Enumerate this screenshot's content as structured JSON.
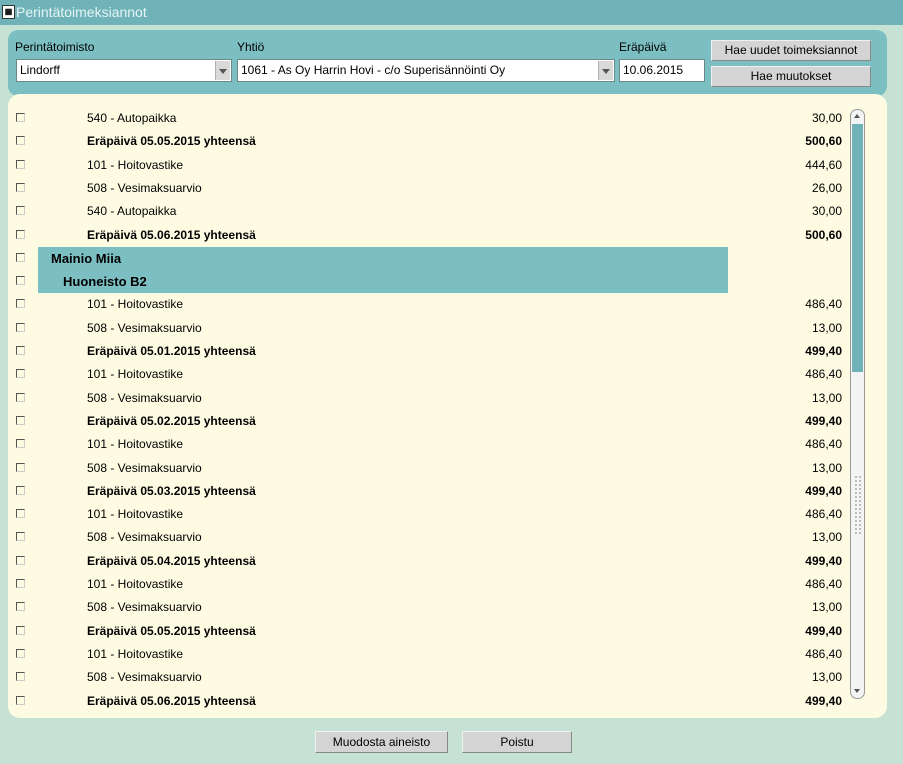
{
  "window": {
    "title": "Perintätoimeksiannot",
    "icon": "app-icon"
  },
  "filters": {
    "agency_label": "Perintätoimisto",
    "agency_value": "Lindorff",
    "company_label": "Yhtiö",
    "company_value": "1061 - As Oy Harrin Hovi - c/o Superisännöinti Oy",
    "due_label": "Eräpäivä",
    "due_value": "10.06.2015",
    "fetch_new_label": "Hae uudet toimeksiannot",
    "fetch_changes_label": "Hae muutokset"
  },
  "rows": [
    {
      "kind": "item",
      "desc": "540 - Autopaikka",
      "amount": "30,00"
    },
    {
      "kind": "total",
      "desc": "Eräpäivä 05.05.2015 yhteensä",
      "amount": "500,60"
    },
    {
      "kind": "item",
      "desc": "101 - Hoitovastike",
      "amount": "444,60"
    },
    {
      "kind": "item",
      "desc": "508 - Vesimaksuarvio",
      "amount": "26,00"
    },
    {
      "kind": "item",
      "desc": "540 - Autopaikka",
      "amount": "30,00"
    },
    {
      "kind": "total",
      "desc": "Eräpäivä 05.06.2015 yhteensä",
      "amount": "500,60"
    },
    {
      "kind": "person",
      "desc": "Mainio Miia",
      "amount": ""
    },
    {
      "kind": "apartment",
      "desc": "Huoneisto B2",
      "amount": ""
    },
    {
      "kind": "item",
      "desc": "101 - Hoitovastike",
      "amount": "486,40"
    },
    {
      "kind": "item",
      "desc": "508 - Vesimaksuarvio",
      "amount": "13,00"
    },
    {
      "kind": "total",
      "desc": "Eräpäivä 05.01.2015 yhteensä",
      "amount": "499,40"
    },
    {
      "kind": "item",
      "desc": "101 - Hoitovastike",
      "amount": "486,40"
    },
    {
      "kind": "item",
      "desc": "508 - Vesimaksuarvio",
      "amount": "13,00"
    },
    {
      "kind": "total",
      "desc": "Eräpäivä 05.02.2015 yhteensä",
      "amount": "499,40"
    },
    {
      "kind": "item",
      "desc": "101 - Hoitovastike",
      "amount": "486,40"
    },
    {
      "kind": "item",
      "desc": "508 - Vesimaksuarvio",
      "amount": "13,00"
    },
    {
      "kind": "total",
      "desc": "Eräpäivä 05.03.2015 yhteensä",
      "amount": "499,40"
    },
    {
      "kind": "item",
      "desc": "101 - Hoitovastike",
      "amount": "486,40"
    },
    {
      "kind": "item",
      "desc": "508 - Vesimaksuarvio",
      "amount": "13,00"
    },
    {
      "kind": "total",
      "desc": "Eräpäivä 05.04.2015 yhteensä",
      "amount": "499,40"
    },
    {
      "kind": "item",
      "desc": "101 - Hoitovastike",
      "amount": "486,40"
    },
    {
      "kind": "item",
      "desc": "508 - Vesimaksuarvio",
      "amount": "13,00"
    },
    {
      "kind": "total",
      "desc": "Eräpäivä 05.05.2015 yhteensä",
      "amount": "499,40"
    },
    {
      "kind": "item",
      "desc": "101 - Hoitovastike",
      "amount": "486,40"
    },
    {
      "kind": "item",
      "desc": "508 - Vesimaksuarvio",
      "amount": "13,00"
    },
    {
      "kind": "total",
      "desc": "Eräpäivä 05.06.2015 yhteensä",
      "amount": "499,40"
    }
  ],
  "footer": {
    "create_label": "Muodosta aineisto",
    "exit_label": "Poistu"
  },
  "scrollbar": {
    "position_fraction": 0.42
  },
  "colors": {
    "accent": "#7cbfc2",
    "list_bg": "#fefbe3",
    "window_bg": "#c6e2d4"
  }
}
